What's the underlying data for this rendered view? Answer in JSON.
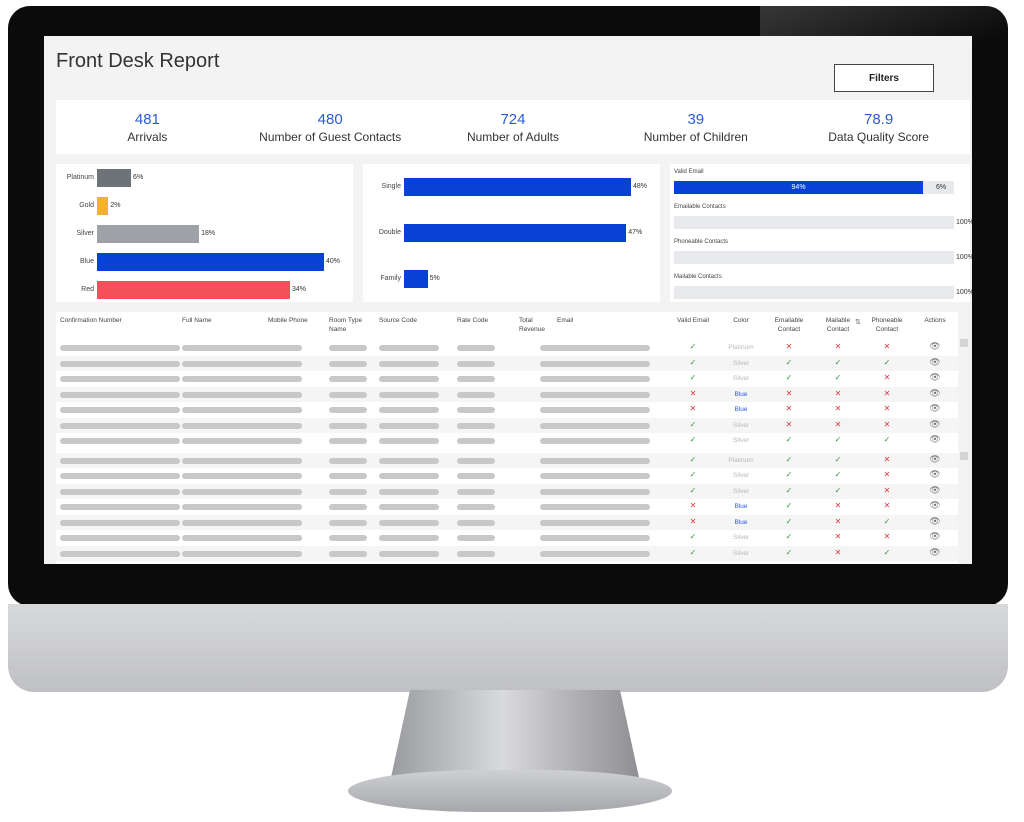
{
  "report": {
    "title": "Front Desk Report",
    "filters_label": "Filters"
  },
  "kpis": [
    {
      "value": "481",
      "label": "Arrivals"
    },
    {
      "value": "480",
      "label": "Number of Guest Contacts"
    },
    {
      "value": "724",
      "label": "Number of Adults"
    },
    {
      "value": "39",
      "label": "Number of Children"
    },
    {
      "value": "78.9",
      "label": "Data Quality Score"
    }
  ],
  "chart_data": [
    {
      "type": "bar",
      "orientation": "horizontal",
      "categories": [
        "Platinum",
        "Gold",
        "Silver",
        "Blue",
        "Red"
      ],
      "values": [
        6,
        2,
        18,
        40,
        34
      ],
      "labels": [
        "6%",
        "2%",
        "18%",
        "40%",
        "34%"
      ],
      "colors": [
        "#6e7378",
        "#f2b230",
        "#9ea1a5",
        "#0841d5",
        "#f2505a"
      ]
    },
    {
      "type": "bar",
      "orientation": "horizontal",
      "categories": [
        "Single",
        "Double",
        "Family"
      ],
      "values": [
        48,
        47,
        5
      ],
      "labels": [
        "48%",
        "47%",
        "5%"
      ],
      "colors": [
        "#0841d5",
        "#0841d5",
        "#0841d5"
      ]
    }
  ],
  "quality_bars": [
    {
      "label": "Valid Email",
      "fill": 94,
      "fill_label": "94%",
      "end_label": "6%"
    },
    {
      "label": "Emailable Contacts",
      "fill": 0,
      "fill_label": "",
      "end_label": "100%"
    },
    {
      "label": "Phoneable Contacts",
      "fill": 0,
      "fill_label": "",
      "end_label": "100%"
    },
    {
      "label": "Mailable Contacts",
      "fill": 0,
      "fill_label": "",
      "end_label": "100%"
    }
  ],
  "table": {
    "headers": {
      "confirmation": "Confirmation Number",
      "full_name": "Full Name",
      "mobile": "Mobile Phone",
      "room_type_1": "Room Type",
      "room_type_2": "Name",
      "source": "Source Code",
      "rate": "Rate Code",
      "revenue_1": "Total",
      "revenue_2": "Revenue",
      "email": "Email",
      "valid_email": "Valid Email",
      "color": "Color",
      "emailable_1": "Emailable",
      "emailable_2": "Contact",
      "mailable_1": "Mailable",
      "mailable_2": "Contact",
      "phoneable_1": "Phoneable",
      "phoneable_2": "Contact",
      "actions": "Actions"
    },
    "rows": [
      {
        "valid_email": true,
        "color": "Platinum",
        "emailable": false,
        "mailable": false,
        "phoneable": false
      },
      {
        "valid_email": true,
        "color": "Silver",
        "emailable": true,
        "mailable": true,
        "phoneable": true
      },
      {
        "valid_email": true,
        "color": "Silver",
        "emailable": true,
        "mailable": true,
        "phoneable": false
      },
      {
        "valid_email": false,
        "color": "Blue",
        "emailable": false,
        "mailable": false,
        "phoneable": false
      },
      {
        "valid_email": false,
        "color": "Blue",
        "emailable": false,
        "mailable": false,
        "phoneable": false
      },
      {
        "valid_email": true,
        "color": "Silver",
        "emailable": false,
        "mailable": false,
        "phoneable": false
      },
      {
        "valid_email": true,
        "color": "Silver",
        "emailable": true,
        "mailable": true,
        "phoneable": true
      },
      {
        "valid_email": true,
        "color": "Platinum",
        "emailable": true,
        "mailable": true,
        "phoneable": false
      },
      {
        "valid_email": true,
        "color": "Silver",
        "emailable": true,
        "mailable": true,
        "phoneable": false
      },
      {
        "valid_email": true,
        "color": "Silver",
        "emailable": true,
        "mailable": true,
        "phoneable": false
      },
      {
        "valid_email": false,
        "color": "Blue",
        "emailable": true,
        "mailable": false,
        "phoneable": false
      },
      {
        "valid_email": false,
        "color": "Blue",
        "emailable": true,
        "mailable": false,
        "phoneable": true
      },
      {
        "valid_email": true,
        "color": "Silver",
        "emailable": true,
        "mailable": false,
        "phoneable": false
      },
      {
        "valid_email": true,
        "color": "Silver",
        "emailable": true,
        "mailable": false,
        "phoneable": true
      }
    ],
    "color_text_colors": {
      "Platinum": "#b9b9b9",
      "Silver": "#b9b9b9",
      "Blue": "#2a5bd7"
    },
    "check_icon": "check-icon",
    "cross_icon": "cross-icon",
    "view_icon": "eye-icon"
  }
}
